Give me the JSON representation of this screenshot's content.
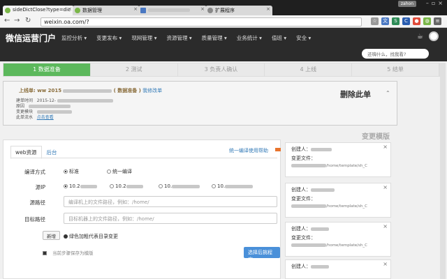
{
  "browser": {
    "tabs": [
      {
        "label": "sideDictClose?type=dic",
        "active": true
      },
      {
        "label": "数据管理",
        "active": false
      },
      {
        "label": "",
        "active": false
      },
      {
        "label": "扩展程序",
        "active": false
      }
    ],
    "user": "zahon",
    "url": "weixin.oa.com/?"
  },
  "header": {
    "brand": "微信运营门户",
    "menu": [
      "监控分析 ▾",
      "变更发布 ▾",
      "现网管理 ▾",
      "资源管理 ▾",
      "质量管理 ▾",
      "业务统计 ▾",
      "值班 ▾",
      "安全 ▾"
    ],
    "search_placeholder": "还嗨什么，找我看?"
  },
  "steps": [
    "1 数据准备",
    "2 测试",
    "3 负责人确认",
    "4 上线",
    "5 结单"
  ],
  "summary": {
    "title_prefix": "上线单: ww 2015",
    "title_status": "( 数据准备 )",
    "title_link": "我修改单",
    "rows": [
      {
        "label": "建单时间",
        "value": "2015-12-"
      },
      {
        "label": "原因"
      },
      {
        "label": "变更模块"
      },
      {
        "label": "此单流水",
        "link": "点击查看"
      }
    ],
    "delete_label": "删除此单"
  },
  "form": {
    "tabs": [
      "web资源",
      "后台"
    ],
    "help_link": "统一编译使用帮助",
    "compile_label": "编译方式",
    "compile_options": [
      "标准",
      "统一编译"
    ],
    "source_ip_label": "源IP",
    "source_ips": [
      "10.2",
      "10.2",
      "10.",
      "10."
    ],
    "source_path_label": "源路径",
    "source_path_placeholder": "编译机上的文件路径，例如：/home/",
    "target_path_label": "目标路径",
    "target_path_placeholder": "目标机器上的文件路径，例如：/home/",
    "add_button": "新增",
    "hint": "绿色加粗代表目录变更",
    "save_template": "当前步骤保存为模版",
    "choose_button": "选择后挑程序"
  },
  "templates": {
    "title": "变更模版",
    "items": [
      {
        "creator": "创建人：",
        "file": "变更文件：",
        "path": "/home/template/sh_C"
      },
      {
        "creator": "创建人：",
        "file": "变更文件：",
        "path": "/home/template/sh_C"
      },
      {
        "creator": "创建人：",
        "file": "变更文件：",
        "path": "/home/template/sh_C"
      },
      {
        "creator": "创建人：",
        "file": "",
        "path": ""
      }
    ]
  }
}
